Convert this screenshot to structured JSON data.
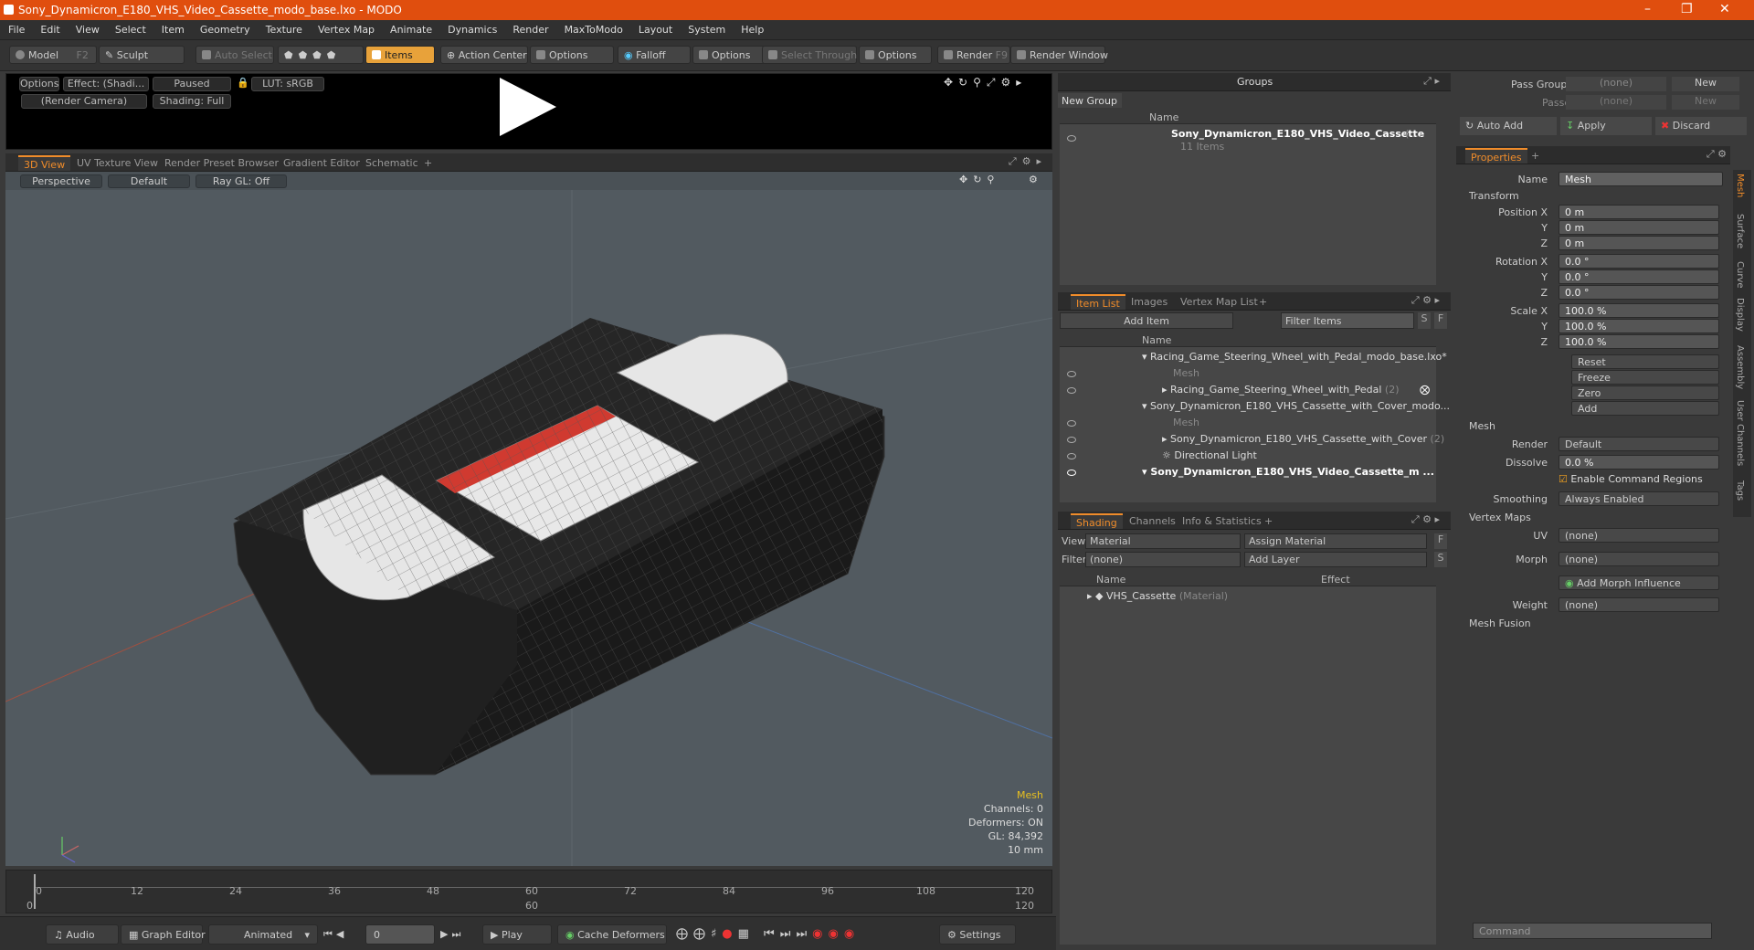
{
  "window": {
    "title": "Sony_Dynamicron_E180_VHS_Video_Cassette_modo_base.lxo - MODO"
  },
  "menu": [
    "File",
    "Edit",
    "View",
    "Select",
    "Item",
    "Geometry",
    "Texture",
    "Vertex Map",
    "Animate",
    "Dynamics",
    "Render",
    "MaxToModo",
    "Layout",
    "System",
    "Help"
  ],
  "toolbar": {
    "model": "Model",
    "model_key": "F2",
    "sculpt": "Sculpt",
    "auto_select": "Auto Select",
    "items": "Items",
    "action_center": "Action Center",
    "options1": "Options",
    "falloff": "Falloff",
    "options2": "Options",
    "select_through": "Select Through",
    "options3": "Options",
    "render": "Render",
    "render_key": "F9",
    "render_window": "Render Window"
  },
  "preview": {
    "options": "Options",
    "effect": "Effect: (Shadi...",
    "paused": "Paused",
    "lut": "LUT: sRGB",
    "camera": "(Render Camera)",
    "shading": "Shading: Full"
  },
  "viewport_tabs": [
    "3D View",
    "UV Texture View",
    "Render Preset Browser",
    "Gradient Editor",
    "Schematic",
    "+"
  ],
  "viewport": {
    "perspective": "Perspective",
    "default": "Default",
    "raygl": "Ray GL: Off"
  },
  "hud": {
    "mesh": "Mesh",
    "channels": "Channels: 0",
    "deformers": "Deformers: ON",
    "gl": "GL: 84,392",
    "scale": "10 mm"
  },
  "timeline": {
    "ticks": [
      "0",
      "12",
      "24",
      "36",
      "48",
      "60",
      "72",
      "84",
      "96",
      "108",
      "120"
    ],
    "lower": [
      "0",
      "60",
      "120"
    ]
  },
  "bottom": {
    "audio": "Audio",
    "graph_editor": "Graph Editor",
    "animated": "Animated",
    "frame": "0",
    "play": "Play",
    "cache": "Cache Deformers",
    "settings": "Settings"
  },
  "groups": {
    "title": "Groups",
    "new_group": "New Group",
    "col_name": "Name",
    "item_name": "Sony_Dynamicron_E180_VHS_Video_Cassette",
    "item_suffix": "( ...",
    "item_count": "11 Items"
  },
  "itemlist": {
    "tabs": [
      "Item List",
      "Images",
      "Vertex Map List",
      "+"
    ],
    "add_item": "Add Item",
    "filter": "Filter Items",
    "s": "S",
    "f": "F",
    "col_name": "Name",
    "rows": [
      {
        "text": "Racing_Game_Steering_Wheel_with_Pedal_modo_base.lxo*",
        "style": "normal"
      },
      {
        "text": "Mesh",
        "style": "dim"
      },
      {
        "text": "Racing_Game_Steering_Wheel_with_Pedal",
        "suffix": "(2)",
        "style": "normal"
      },
      {
        "text": "Sony_Dynamicron_E180_VHS_Cassette_with_Cover_modo...",
        "style": "normal"
      },
      {
        "text": "Mesh",
        "style": "dim"
      },
      {
        "text": "Sony_Dynamicron_E180_VHS_Cassette_with_Cover",
        "suffix": "(2)",
        "style": "normal"
      },
      {
        "text": "Directional Light",
        "style": "normal"
      },
      {
        "text": "Sony_Dynamicron_E180_VHS_Video_Cassette_m ...",
        "style": "bold"
      }
    ]
  },
  "shading": {
    "tabs": [
      "Shading",
      "Channels",
      "Info & Statistics",
      "+"
    ],
    "view_label": "View",
    "view_value": "Material",
    "assign": "Assign Material",
    "f": "F",
    "filter_label": "Filter",
    "filter_value": "(none)",
    "add_layer": "Add Layer",
    "s": "S",
    "col_name": "Name",
    "col_effect": "Effect",
    "row_name": "VHS_Cassette",
    "row_type": "(Material)"
  },
  "passes": {
    "pass_groups": "Pass Groups",
    "passes": "Passes",
    "none": "(none)",
    "new": "New",
    "auto_add": "Auto Add",
    "apply": "Apply",
    "discard": "Discard"
  },
  "properties": {
    "tab": "Properties",
    "plus": "+",
    "name_label": "Name",
    "name_value": "Mesh",
    "transform": "Transform",
    "pos_label": "Position X",
    "y": "Y",
    "z": "Z",
    "pos": [
      "0 m",
      "0 m",
      "0 m"
    ],
    "rot_label": "Rotation X",
    "rot": [
      "0.0 °",
      "0.0 °",
      "0.0 °"
    ],
    "scale_label": "Scale X",
    "scale": [
      "100.0 %",
      "100.0 %",
      "100.0 %"
    ],
    "reset": "Reset",
    "freeze": "Freeze",
    "zero": "Zero",
    "add": "Add",
    "mesh": "Mesh",
    "render_label": "Render",
    "render_value": "Default",
    "dissolve_label": "Dissolve",
    "dissolve_value": "0.0 %",
    "enable_cmd": "Enable Command Regions",
    "smoothing_label": "Smoothing",
    "smoothing_value": "Always Enabled",
    "vertex_maps": "Vertex Maps",
    "uv_label": "UV",
    "uv_value": "(none)",
    "morph_label": "Morph",
    "morph_value": "(none)",
    "add_morph": "Add Morph Influence",
    "weight_label": "Weight",
    "weight_value": "(none)",
    "mesh_fusion": "Mesh Fusion",
    "side_tabs": [
      "Mesh",
      "Surface",
      "Curve",
      "Display",
      "Assembly",
      "User Channels",
      "Tags"
    ],
    "command": "Command"
  },
  "colors": {
    "accent": "#f08c2a",
    "titlebar": "#e04e0e"
  }
}
